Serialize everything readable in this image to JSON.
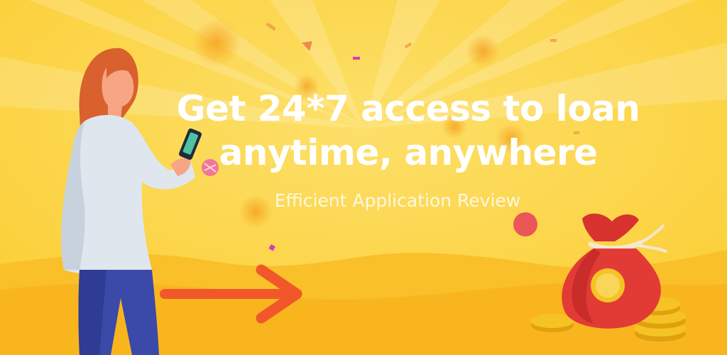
{
  "banner": {
    "headline_line1": "Get 24*7 access to loan",
    "headline_line2": "anytime, anywhere",
    "subtitle": "Efficient Application Review"
  },
  "icons": {
    "woman": "woman-holding-phone-illustration",
    "phone": "smartphone-icon",
    "arrow": "arrow-right-icon",
    "money_bag": "money-bag-icon",
    "coins": "gold-coins-icon"
  },
  "colors": {
    "background": "#fcd23c",
    "hill": "#f9b81f",
    "arrow": "#f0582a",
    "bag": "#e23b36",
    "coin": "#f6c325",
    "headline_text": "#ffffff"
  }
}
